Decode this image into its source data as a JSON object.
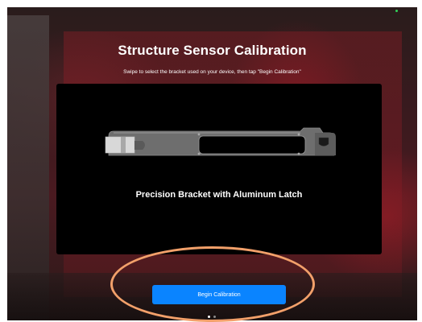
{
  "screen": {
    "title": "Structure Sensor Calibration",
    "instruction": "Swipe to select the bracket used on your device, then tap \"Begin Calibration\""
  },
  "bracket_card": {
    "label": "Precision Bracket with Aluminum Latch",
    "image": "bracket-illustration"
  },
  "actions": {
    "begin_label": "Begin Calibration"
  },
  "pager": {
    "pages": 2,
    "current": 1
  },
  "colors": {
    "accent": "#0a84ff",
    "highlight": "#f2a06a",
    "card": "#000000"
  }
}
